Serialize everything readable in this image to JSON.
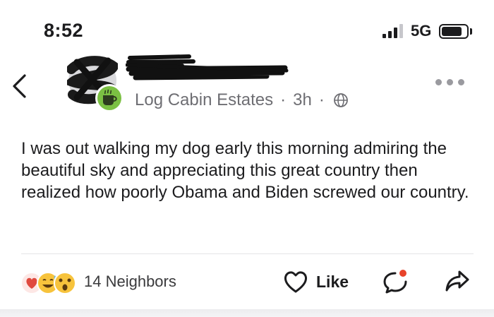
{
  "status_bar": {
    "time": "8:52",
    "network": "5G"
  },
  "post": {
    "author_name_redacted": true,
    "location": "Log Cabin Estates",
    "separator": "·",
    "age": "3h",
    "text": "I was out walking my dog early this morning admiring the beautiful sky and appreciating this great country then realized how poorly Obama and Biden screwed our country."
  },
  "footer": {
    "reaction_count": "14 Neighbors",
    "reactions": [
      "heart",
      "grinning-sweat",
      "surprised"
    ],
    "like_label": "Like"
  },
  "icons": {
    "back": "chevron-left-icon",
    "more": "ellipsis-icon",
    "visibility": "globe-icon",
    "comment": "comment-bubble-icon",
    "share": "share-arrow-icon"
  },
  "colors": {
    "badge_green": "#7bc043",
    "text": "#1c1c1e",
    "meta_text": "#6e6e73",
    "heart_red": "#e04a3f",
    "emoji_yellow": "#f7c33c",
    "notification_red": "#e8432a"
  }
}
